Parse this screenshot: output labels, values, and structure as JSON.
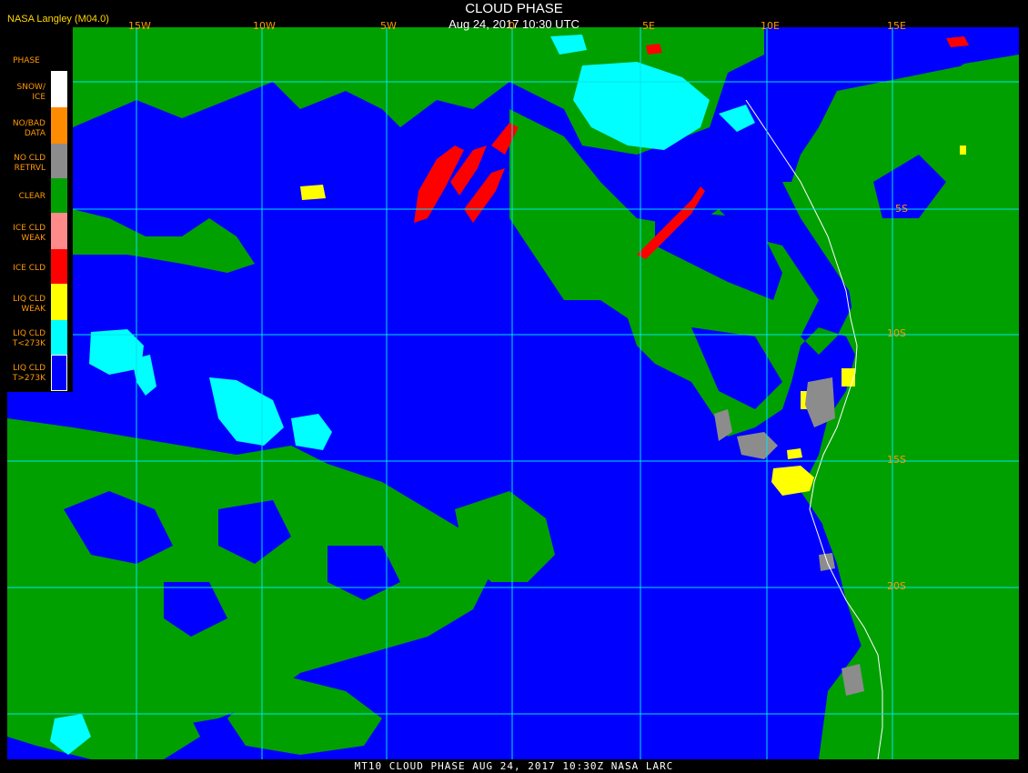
{
  "header": {
    "org": "NASA Langley (M04.0)",
    "title": "CLOUD PHASE",
    "time": "Aug 24, 2017 10:30 UTC"
  },
  "footer": "MT10  CLOUD PHASE   AUG 24, 2017 10:30Z   NASA LARC",
  "legend": {
    "title": "PHASE",
    "items": [
      {
        "label": "SNOW/\nICE",
        "color": "#ffffff"
      },
      {
        "label": "NO/BAD\nDATA",
        "color": "#ff8c00"
      },
      {
        "label": "NO CLD\nRETRVL",
        "color": "#8c8c8c"
      },
      {
        "label": "CLEAR",
        "color": "#00a000"
      },
      {
        "label": "ICE CLD\nWEAK",
        "color": "#ff8a8a"
      },
      {
        "label": "ICE CLD",
        "color": "#ff0000"
      },
      {
        "label": "LIQ CLD\nWEAK",
        "color": "#ffff00"
      },
      {
        "label": "LIQ CLD\nT<273K",
        "color": "#00ffff"
      },
      {
        "label": "LIQ CLD\nT>273K",
        "color": "#0000ff"
      }
    ]
  },
  "grid": {
    "lon_labels": [
      "15W",
      "10W",
      "5W",
      "0",
      "5E",
      "10E",
      "15E"
    ],
    "lat_labels": [
      "5S",
      "10S",
      "15S",
      "20S"
    ],
    "line_color": "#00e5ee"
  },
  "colors": {
    "ocean_liq_warm": "#0000ff",
    "clear": "#00a000",
    "liq_cold": "#00ffff",
    "ice": "#ff0000",
    "liq_weak": "#ffff00",
    "no_retrieval": "#8c8c8c",
    "coastline": "#ffffff"
  }
}
